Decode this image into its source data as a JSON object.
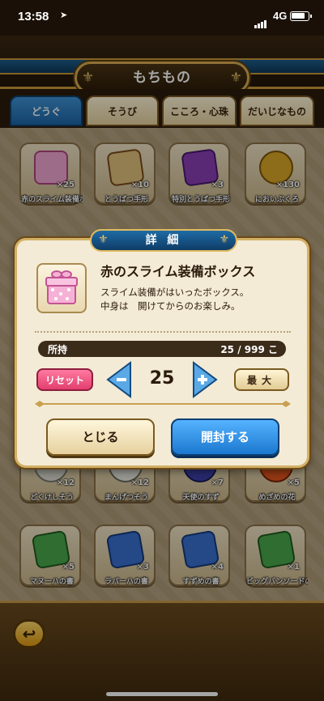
{
  "status_bar": {
    "time": "13:58",
    "network": "4G"
  },
  "header": {
    "title": "もちもの"
  },
  "tabs": [
    {
      "label": "どうぐ",
      "active": true
    },
    {
      "label": "そうび",
      "active": false
    },
    {
      "label": "こころ・心珠",
      "active": false
    },
    {
      "label": "だいじなもの",
      "active": false
    }
  ],
  "items": [
    {
      "name": "赤のスライム装備ボックス",
      "count": "×25",
      "icon": "pink-gift-box-icon"
    },
    {
      "name": "とうばつ手形",
      "count": "×10",
      "icon": "brown-ticket-icon"
    },
    {
      "name": "特別とうばつ手形",
      "count": "×3",
      "icon": "purple-ticket-icon"
    },
    {
      "name": "においぶくろ",
      "count": "×130",
      "icon": "scent-pouch-icon"
    },
    {
      "name": "どくけしそう",
      "count": "×12",
      "icon": "antidote-herb-icon"
    },
    {
      "name": "まんげつそう",
      "count": "×12",
      "icon": "moon-herb-icon"
    },
    {
      "name": "天使のすず",
      "count": "×7",
      "icon": "angel-bell-icon"
    },
    {
      "name": "めざめの花",
      "count": "×5",
      "icon": "awakening-flower-icon"
    },
    {
      "name": "マヌーハの書",
      "count": "×5",
      "icon": "green-scroll-icon"
    },
    {
      "name": "ラバーハの書",
      "count": "×3",
      "icon": "blue-scroll-icon"
    },
    {
      "name": "すずめの書",
      "count": "×4",
      "icon": "blue-scroll-icon"
    },
    {
      "name": "ビッグバンソードの書",
      "count": "×1",
      "icon": "green-scroll-icon"
    }
  ],
  "dialog": {
    "title": "詳 細",
    "item_name": "赤のスライム装備ボックス",
    "description": "スライム装備がはいったボックス。\n中身は　開けてからのお楽しみ。",
    "owned_label": "所持",
    "owned_value": "25 / 999 こ",
    "reset_label": "リセット",
    "quantity": "25",
    "max_label": "最大",
    "close_label": "とじる",
    "open_label": "開封する"
  },
  "colors": {
    "accent_blue": "#1c66a8",
    "gold": "#d3b066",
    "reset_pink": "#e23e6e"
  }
}
